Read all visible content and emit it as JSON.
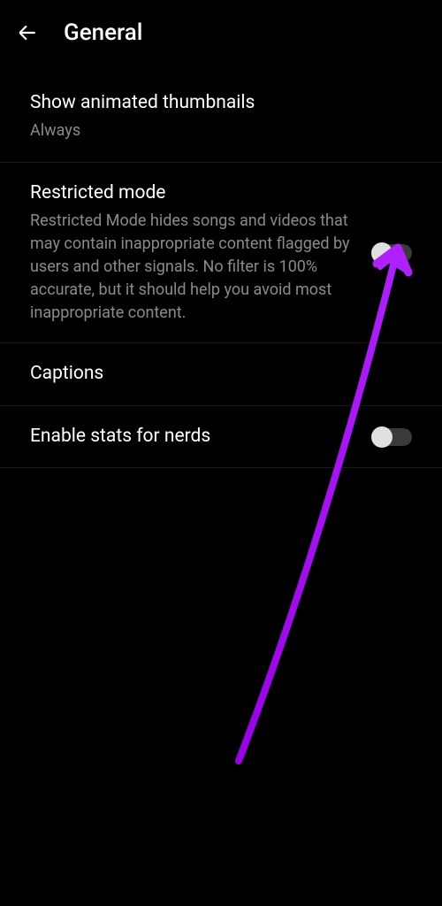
{
  "header": {
    "title": "General"
  },
  "settings": {
    "animated_thumbnails": {
      "title": "Show animated thumbnails",
      "subtitle": "Always"
    },
    "restricted_mode": {
      "title": "Restricted mode",
      "description": "Restricted Mode hides songs and videos that may contain inappropriate content flagged by users and other signals. No filter is 100% accurate, but it should help you avoid most inappropriate content.",
      "toggle": false
    },
    "captions": {
      "title": "Captions"
    },
    "stats_for_nerds": {
      "title": "Enable stats for nerds",
      "toggle": false
    }
  },
  "annotation": {
    "color": "#9b00e8"
  }
}
